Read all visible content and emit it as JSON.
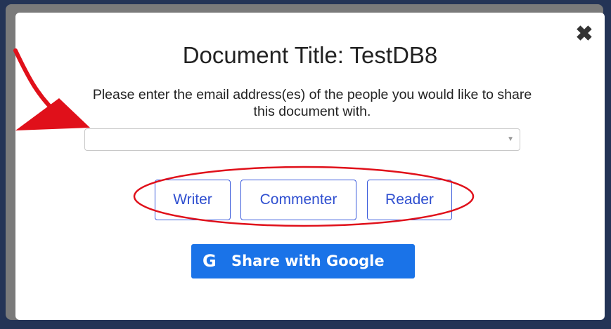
{
  "modal": {
    "title": "Document Title: TestDB8",
    "instructions": "Please enter the email address(es) of the people you would like to share this document with.",
    "close_icon": "close-icon",
    "email_select": {
      "value": "",
      "placeholder": ""
    },
    "roles": [
      {
        "label": "Writer"
      },
      {
        "label": "Commenter"
      },
      {
        "label": "Reader"
      }
    ],
    "share_button": {
      "icon": "google-g-icon",
      "label": "Share with Google",
      "color": "#1a73e8"
    }
  },
  "annotations": {
    "arrow_color": "#e0101a",
    "ellipse_color": "#e0101a"
  }
}
